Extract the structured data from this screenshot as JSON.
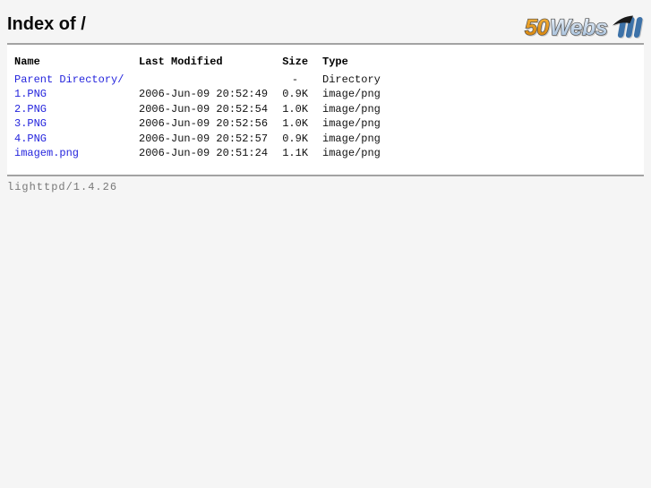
{
  "page": {
    "title": "Index of /",
    "server_signature": "lighttpd/1.4.26"
  },
  "logo": {
    "text_50": "50",
    "text_webs": "Webs",
    "colors": {
      "fifty_gradient_top": "#f6b43d",
      "fifty_gradient_bottom": "#d07c05",
      "webs_gradient_top": "#eef3f9",
      "webs_gradient_bottom": "#9bb9d8",
      "outline": "#4a4a4a",
      "mark_blue": "#3d72a8",
      "mark_flag_black": "#1a1a1a"
    }
  },
  "listing": {
    "headers": {
      "name": "Name",
      "modified": "Last Modified",
      "size": "Size",
      "type": "Type"
    },
    "rows": [
      {
        "name": "Parent Directory/",
        "modified": "",
        "size": "-",
        "type": "Directory"
      },
      {
        "name": "1.PNG",
        "modified": "2006-Jun-09 20:52:49",
        "size": "0.9K",
        "type": "image/png"
      },
      {
        "name": "2.PNG",
        "modified": "2006-Jun-09 20:52:54",
        "size": "1.0K",
        "type": "image/png"
      },
      {
        "name": "3.PNG",
        "modified": "2006-Jun-09 20:52:56",
        "size": "1.0K",
        "type": "image/png"
      },
      {
        "name": "4.PNG",
        "modified": "2006-Jun-09 20:52:57",
        "size": "0.9K",
        "type": "image/png"
      },
      {
        "name": "imagem.png",
        "modified": "2006-Jun-09 20:51:24",
        "size": "1.1K",
        "type": "image/png"
      }
    ]
  },
  "theme": {
    "page_bg": "#f5f5f5",
    "panel_bg": "#ffffff",
    "rule_color": "#a3a3a3",
    "link_color": "#2424dd",
    "footer_color": "#787878"
  }
}
